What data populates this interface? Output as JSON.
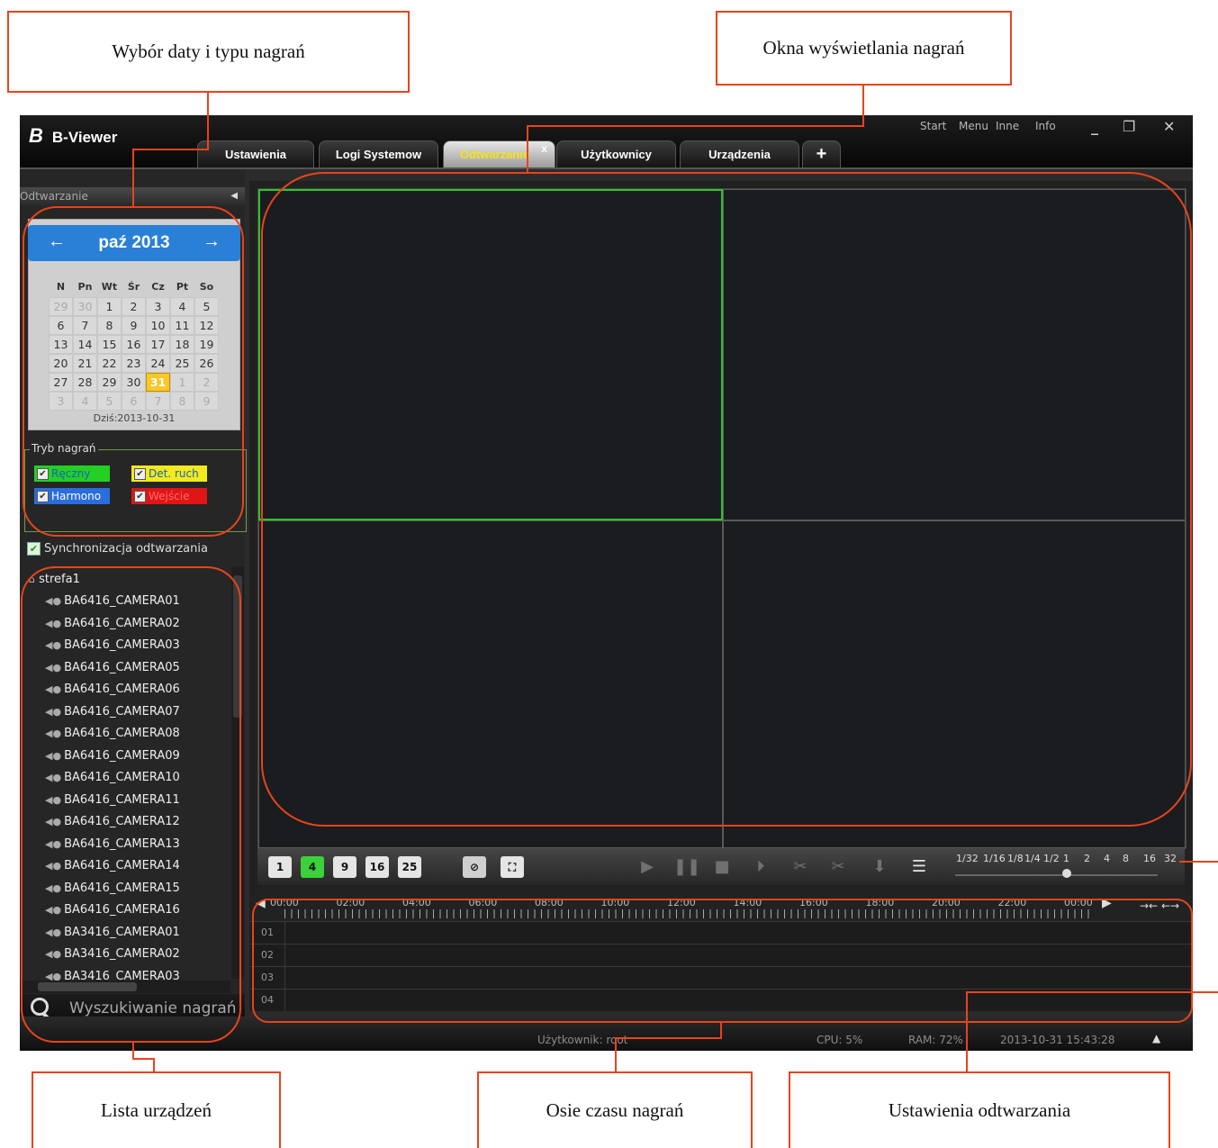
{
  "annotations": {
    "date_type": "Wybór daty i typu nagrań",
    "display_windows": "Okna wyświetlania nagrań",
    "device_list": "Lista urządzeń",
    "timelines": "Osie czasu nagrań",
    "playback_settings": "Ustawienia odtwarzania"
  },
  "app": {
    "title": "B-Viewer",
    "menu": [
      "Start",
      "Menu",
      "Inne",
      "Info"
    ],
    "tabs": [
      {
        "label": "Ustawienia",
        "active": false
      },
      {
        "label": "Logi Systemow",
        "active": false
      },
      {
        "label": "Odtwarzanie",
        "active": true
      },
      {
        "label": "Użytkownicy",
        "active": false
      },
      {
        "label": "Urządzenia",
        "active": false
      }
    ],
    "tab_close": "x",
    "tab_add": "+"
  },
  "sidebar": {
    "header": "Odtwarzanie",
    "calendar": {
      "month_year": "paź 2013",
      "prev_icon": "←",
      "next_icon": "→",
      "weekdays": [
        "N",
        "Pn",
        "Wt",
        "Śr",
        "Cz",
        "Pt",
        "So"
      ],
      "weeks": [
        [
          "29",
          "30",
          "1",
          "2",
          "3",
          "4",
          "5"
        ],
        [
          "6",
          "7",
          "8",
          "9",
          "10",
          "11",
          "12"
        ],
        [
          "13",
          "14",
          "15",
          "16",
          "17",
          "18",
          "19"
        ],
        [
          "20",
          "21",
          "22",
          "23",
          "24",
          "25",
          "26"
        ],
        [
          "27",
          "28",
          "29",
          "30",
          "31",
          "1",
          "2"
        ],
        [
          "3",
          "4",
          "5",
          "6",
          "7",
          "8",
          "9"
        ]
      ],
      "selected": "31",
      "today_label": "Dziś:2013-10-31"
    },
    "record_mode": {
      "title": "Tryb nagrań",
      "options": [
        {
          "label": "Ręczny",
          "color": "#23d023",
          "text_color": "#1a5fc4"
        },
        {
          "label": "Det. ruch",
          "color": "#f2ea1b",
          "text_color": "#1a5fc4"
        },
        {
          "label": "Harmono",
          "color": "#2a6ddd",
          "text_color": "#ffffff"
        },
        {
          "label": "Wejście",
          "color": "#e01515",
          "text_color": "#ff6b6b"
        }
      ]
    },
    "sync_label": "Synchronizacja odtwarzania",
    "tree": {
      "root": "strefa1",
      "cameras": [
        "BA6416_CAMERA01",
        "BA6416_CAMERA02",
        "BA6416_CAMERA03",
        "BA6416_CAMERA05",
        "BA6416_CAMERA06",
        "BA6416_CAMERA07",
        "BA6416_CAMERA08",
        "BA6416_CAMERA09",
        "BA6416_CAMERA10",
        "BA6416_CAMERA11",
        "BA6416_CAMERA12",
        "BA6416_CAMERA13",
        "BA6416_CAMERA14",
        "BA6416_CAMERA15",
        "BA6416_CAMERA16",
        "BA3416_CAMERA01",
        "BA3416_CAMERA02",
        "BA3416_CAMERA03"
      ]
    },
    "search_label": "Wyszukiwanie nagrań"
  },
  "controls": {
    "layouts": [
      "1",
      "4",
      "9",
      "16",
      "25"
    ],
    "active_layout": "4",
    "speeds": [
      "1/32",
      "1/16",
      "1/8",
      "1/4",
      "1/2",
      "1",
      "2",
      "4",
      "8",
      "16",
      "32"
    ],
    "current_speed": "1"
  },
  "timeline": {
    "hours": [
      "00:00",
      "02:00",
      "04:00",
      "06:00",
      "08:00",
      "10:00",
      "12:00",
      "14:00",
      "16:00",
      "18:00",
      "20:00",
      "22:00",
      "00:00"
    ],
    "rows": [
      "01",
      "02",
      "03",
      "04"
    ]
  },
  "status": {
    "user": "Użytkownik: root",
    "cpu": "CPU: 5%",
    "ram": "RAM: 72%",
    "datetime": "2013-10-31 15:43:28"
  }
}
